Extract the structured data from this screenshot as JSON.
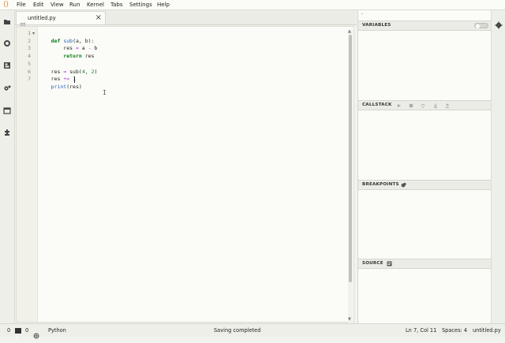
{
  "menubar": {
    "items": [
      "File",
      "Edit",
      "View",
      "Run",
      "Kernel",
      "Tabs",
      "Settings",
      "Help"
    ]
  },
  "sidebar": {
    "icons": [
      "folder-icon",
      "running-icon",
      "command-palette-icon",
      "gear-settings-icon",
      "tabs-icon",
      "extension-icon"
    ]
  },
  "editor": {
    "tab_title": "untitled.py",
    "tab_close": "×",
    "line_numbers": [
      "1",
      "2",
      "3",
      "4",
      "5",
      "6",
      "7"
    ],
    "lines": [
      "def sub(a, b):",
      "    res = a - b",
      "    return res",
      "",
      "res = sub(4, 2)",
      "res += 1",
      "print(res)"
    ]
  },
  "debugger": {
    "variables_title": "VARIABLES",
    "callstack_title": "CALLSTACK",
    "breakpoints_title": "BREAKPOINTS",
    "source_title": "SOURCE"
  },
  "statusbar": {
    "left_count_1": "0",
    "left_count_2": "0",
    "kernel": "Python",
    "message": "Saving completed",
    "position": "Ln 7, Col 11",
    "spaces": "Spaces: 4",
    "file": "untitled.py"
  }
}
